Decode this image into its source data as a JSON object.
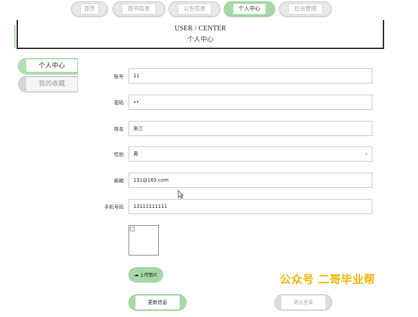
{
  "nav": {
    "items": [
      {
        "label": "首页",
        "active": false
      },
      {
        "label": "图书信息",
        "active": false
      },
      {
        "label": "公告信息",
        "active": false
      },
      {
        "label": "个人中心",
        "active": true
      },
      {
        "label": "后台管理",
        "active": false
      }
    ]
  },
  "header": {
    "title_en": "USER / CENTER",
    "title_cn": "个人中心"
  },
  "sidebar": {
    "items": [
      {
        "label": "个人中心",
        "active": true
      },
      {
        "label": "我的收藏",
        "active": false
      }
    ]
  },
  "form": {
    "account": {
      "label": "账号",
      "value": "11"
    },
    "password": {
      "label": "密码",
      "value": "••"
    },
    "name": {
      "label": "姓名",
      "value": "张三"
    },
    "gender": {
      "label": "性别",
      "value": "男"
    },
    "email": {
      "label": "邮箱",
      "value": "131@163.com"
    },
    "phone": {
      "label": "手机号码",
      "value": "13111111111"
    }
  },
  "upload": {
    "label": "上传图片",
    "icon": "cloud-upload-icon"
  },
  "actions": {
    "update_label": "更新信息",
    "logout_label": "退出登录"
  },
  "watermark": "公众号 二哥毕业帮",
  "colors": {
    "accent": "#a7d9a7",
    "watermark": "#f2b300"
  }
}
